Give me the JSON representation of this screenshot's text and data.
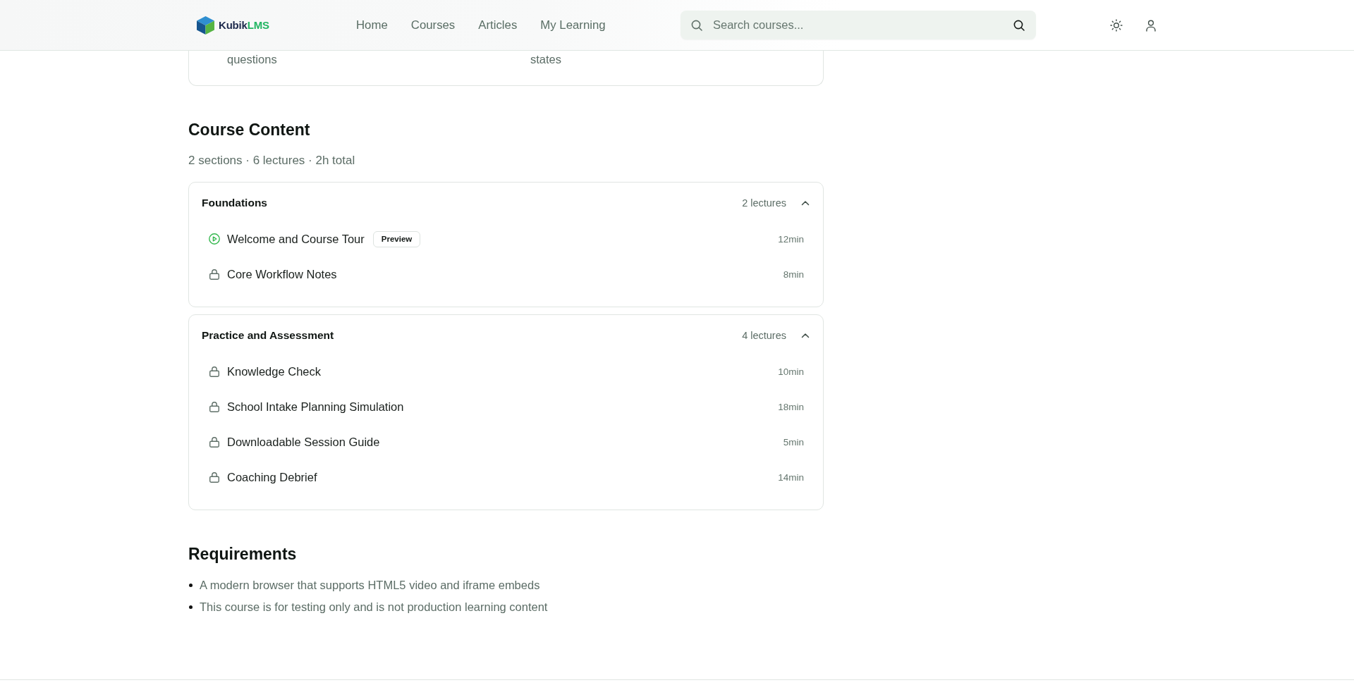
{
  "header": {
    "logo": {
      "primary": "Kubik",
      "accent": "LMS"
    },
    "nav": [
      "Home",
      "Courses",
      "Articles",
      "My Learning"
    ],
    "search": {
      "placeholder": "Search courses..."
    }
  },
  "top_card": {
    "texts": [
      "questions",
      "states"
    ]
  },
  "course_content": {
    "title": "Course Content",
    "summary": "2 sections · 6 lectures · 2h total",
    "sections": [
      {
        "title": "Foundations",
        "count": "2 lectures",
        "expanded": true,
        "lectures": [
          {
            "title": "Welcome and Course Tour",
            "locked": false,
            "badge": "Preview",
            "duration": "12min"
          },
          {
            "title": "Core Workflow Notes",
            "locked": true,
            "duration": "8min"
          }
        ]
      },
      {
        "title": "Practice and Assessment",
        "count": "4 lectures",
        "expanded": true,
        "lectures": [
          {
            "title": "Knowledge Check",
            "locked": true,
            "duration": "10min"
          },
          {
            "title": "School Intake Planning Simulation",
            "locked": true,
            "duration": "18min"
          },
          {
            "title": "Downloadable Session Guide",
            "locked": true,
            "duration": "5min"
          },
          {
            "title": "Coaching Debrief",
            "locked": true,
            "duration": "14min"
          }
        ]
      }
    ]
  },
  "requirements": {
    "title": "Requirements",
    "items": [
      "A modern browser that supports HTML5 video and iframe embeds",
      "This course is for testing only and is not production learning content"
    ]
  }
}
